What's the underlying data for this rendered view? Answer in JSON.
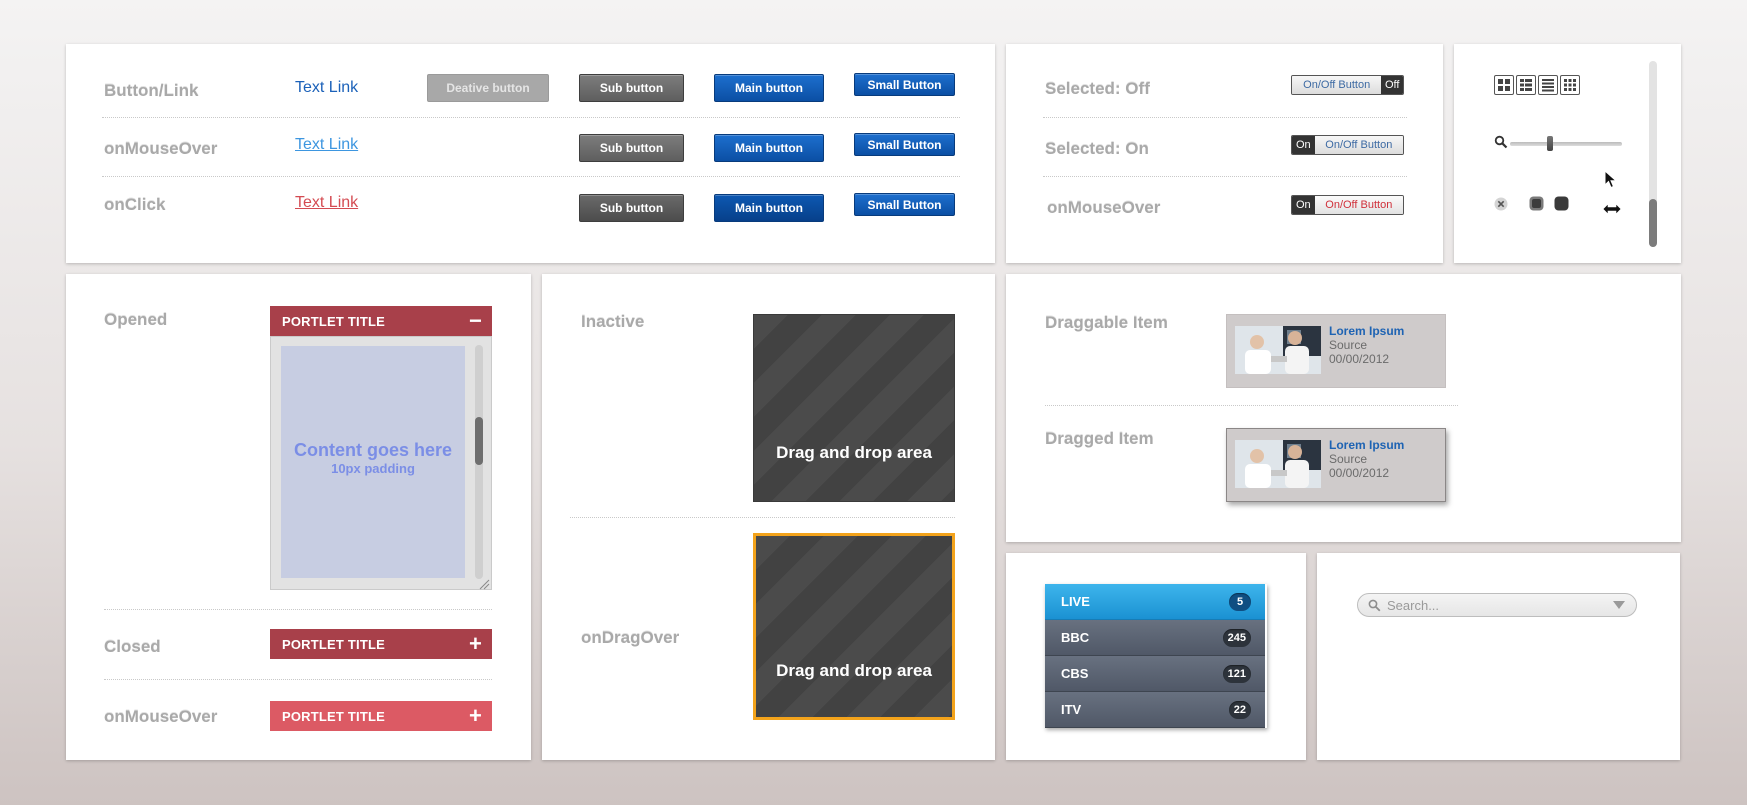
{
  "buttons_panel": {
    "row_labels": [
      "Button/Link",
      "onMouseOver",
      "onClick"
    ],
    "text_link": "Text Link",
    "deactive_button": "Deative button",
    "sub_button": "Sub button",
    "main_button": "Main button",
    "small_button": "Small Button"
  },
  "toggle_panel": {
    "row_labels": [
      "Selected: Off",
      "Selected: On",
      "onMouseOver"
    ],
    "toggle_label": "On/Off Button",
    "off_label": "Off",
    "on_label": "On"
  },
  "controls_panel": {
    "view_icons": [
      "grid-large-icon",
      "grid-list-icon",
      "list-icon",
      "grid-small-icon"
    ],
    "zoom_slider_value": 0.35
  },
  "portlet_panel": {
    "row_labels": [
      "Opened",
      "Closed",
      "onMouseOver"
    ],
    "portlet_title": "PORTLET TITLE",
    "collapse_symbol": "−",
    "expand_symbol": "+",
    "content_text": "Content goes here",
    "content_sub": "10px padding"
  },
  "drag_panel": {
    "row_labels": [
      "Inactive",
      "onDragOver"
    ],
    "drop_text": "Drag and drop area"
  },
  "draggable_panel": {
    "row_labels": [
      "Draggable Item",
      "Dragged Item"
    ],
    "item_title": "Lorem Ipsum",
    "item_source": "Source",
    "item_date": "00/00/2012"
  },
  "channels": [
    {
      "name": "LIVE",
      "count": "5",
      "active": true
    },
    {
      "name": "BBC",
      "count": "245",
      "active": false
    },
    {
      "name": "CBS",
      "count": "121",
      "active": false
    },
    {
      "name": "ITV",
      "count": "22",
      "active": false
    }
  ],
  "search": {
    "placeholder": "Search..."
  },
  "colors": {
    "primary_blue": "#0b4fa4",
    "portlet_red": "#a8404a",
    "portlet_hover": "#dc5a64",
    "drag_highlight": "#f3a31b",
    "live_blue": "#1b91d2"
  }
}
